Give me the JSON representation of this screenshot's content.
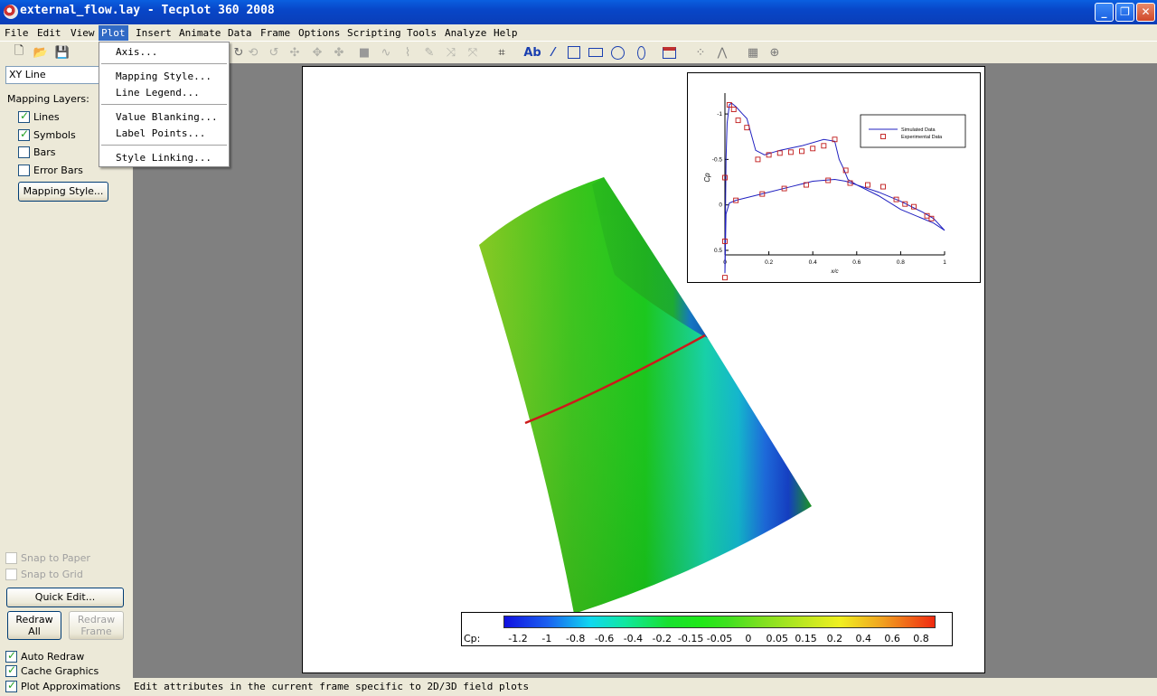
{
  "window": {
    "title": "external_flow.lay - Tecplot 360 2008",
    "controls": [
      "_",
      "❐",
      "✕"
    ]
  },
  "menubar": [
    {
      "label": "File",
      "active": false
    },
    {
      "label": "Edit",
      "active": false
    },
    {
      "label": "View",
      "active": false
    },
    {
      "label": "Plot",
      "active": true
    },
    {
      "label": "Insert",
      "active": false
    },
    {
      "label": "Animate",
      "active": false
    },
    {
      "label": "Data",
      "active": false
    },
    {
      "label": "Frame",
      "active": false
    },
    {
      "label": "Options",
      "active": false
    },
    {
      "label": "Scripting",
      "active": false
    },
    {
      "label": "Tools",
      "active": false
    },
    {
      "label": "Analyze",
      "active": false
    },
    {
      "label": "Help",
      "active": false
    }
  ],
  "plot_menu": [
    {
      "label": "Axis..."
    },
    {
      "label": "Mapping Style..."
    },
    {
      "label": "Line Legend..."
    },
    {
      "label": "Value Blanking..."
    },
    {
      "label": "Label Points..."
    },
    {
      "label": "Style Linking..."
    }
  ],
  "toolbar": {
    "text_tool_label": "Ab",
    "icons": [
      "new-file-icon",
      "open-folder-icon",
      "save-icon",
      "print-icon",
      "rotate-icon",
      "zoom-icon",
      "translate-icon",
      "probe-icon",
      "slice-icon",
      "streamtrace-icon",
      "contour-icon",
      "adjustor-icon",
      "select-icon",
      "text-icon",
      "polyline-icon",
      "rectangle-icon",
      "square-icon",
      "circle-icon",
      "ellipse-icon",
      "frame-icon",
      "scatter-icon",
      "line-icon",
      "grid-icon",
      "polar-icon"
    ]
  },
  "sidebar": {
    "plot_type": "XY Line",
    "mapping_layers_label": "Mapping Layers:",
    "layers": [
      {
        "label": "Lines",
        "checked": true
      },
      {
        "label": "Symbols",
        "checked": true
      },
      {
        "label": "Bars",
        "checked": false
      },
      {
        "label": "Error Bars",
        "checked": false
      }
    ],
    "mapping_style_button": "Mapping Style...",
    "snap": [
      {
        "label": "Snap to Paper",
        "checked": false,
        "enabled": false
      },
      {
        "label": "Snap to Grid",
        "checked": false,
        "enabled": false
      }
    ],
    "quick_edit_button": "Quick Edit...",
    "redraw_all_button": [
      "Redraw",
      "All"
    ],
    "redraw_frame_button": [
      "Redraw",
      "Frame"
    ],
    "options": [
      {
        "label": "Auto Redraw",
        "checked": true
      },
      {
        "label": "Cache Graphics",
        "checked": true
      },
      {
        "label": "Plot Approximations",
        "checked": true
      }
    ]
  },
  "status_text": "Edit attributes in the current frame specific to 2D/3D field plots",
  "colors": {
    "highlight": "#316ac5",
    "titlebar": "#0846c8",
    "surface_cut": "#cc1a1a",
    "simulated": "#2020c0",
    "experimental": "#c01818"
  },
  "colorbar": {
    "variable_label": "Cp:",
    "ticks": [
      "-1.2",
      "-1",
      "-0.8",
      "-0.6",
      "-0.4",
      "-0.2",
      "-0.15",
      "-0.05",
      "0",
      "0.05",
      "0.15",
      "0.2",
      "0.4",
      "0.6",
      "0.8"
    ]
  },
  "chart_data": {
    "type": "line",
    "xlabel": "x/c",
    "ylabel": "Cp",
    "xlim": [
      0,
      1
    ],
    "ylim": [
      0.55,
      -1.15
    ],
    "y_inverted": true,
    "xticks": [
      "0",
      "0.2",
      "0.4",
      "0.6",
      "0.8",
      "1"
    ],
    "yticks": [
      "-1",
      "-0.5",
      "0",
      "0.5"
    ],
    "legend": {
      "placement": "top-right",
      "entries": [
        "Simulated Data",
        "Experimental Data"
      ]
    },
    "series": [
      {
        "name": "Simulated Data",
        "style": "line",
        "x": [
          0,
          0.002,
          0.005,
          0.01,
          0.02,
          0.03,
          0.05,
          0.08,
          0.1,
          0.14,
          0.18,
          0.25,
          0.35,
          0.45,
          0.5,
          0.52,
          0.54,
          0.56,
          0.6,
          0.7,
          0.8,
          0.9,
          0.95,
          1.0
        ],
        "y": [
          0.75,
          0.2,
          -0.5,
          -0.9,
          -1.1,
          -1.12,
          -1.08,
          -1.0,
          -0.95,
          -0.6,
          -0.55,
          -0.6,
          -0.65,
          -0.72,
          -0.7,
          -0.5,
          -0.4,
          -0.28,
          -0.22,
          -0.1,
          0.05,
          0.15,
          0.2,
          0.28
        ]
      },
      {
        "name": "Simulated Data",
        "style": "line",
        "x": [
          0,
          0.005,
          0.02,
          0.05,
          0.1,
          0.2,
          0.3,
          0.4,
          0.5,
          0.55,
          0.6,
          0.7,
          0.8,
          0.9,
          0.95,
          1.0
        ],
        "y": [
          0.75,
          0.1,
          -0.02,
          -0.05,
          -0.08,
          -0.14,
          -0.2,
          -0.26,
          -0.28,
          -0.26,
          -0.22,
          -0.14,
          -0.04,
          0.08,
          0.15,
          0.28
        ]
      },
      {
        "name": "Experimental Data",
        "style": "markers",
        "x": [
          0.02,
          0.04,
          0.06,
          0.1,
          0.15,
          0.2,
          0.25,
          0.3,
          0.35,
          0.4,
          0.45,
          0.5,
          0.55
        ],
        "y": [
          -1.1,
          -1.05,
          -0.93,
          -0.85,
          -0.5,
          -0.55,
          -0.57,
          -0.58,
          -0.59,
          -0.62,
          -0.65,
          -0.72,
          -0.38
        ]
      },
      {
        "name": "Experimental Data",
        "style": "markers",
        "x": [
          0,
          0.0,
          0.0,
          0.05,
          0.17,
          0.27,
          0.37,
          0.47,
          0.57,
          0.65,
          0.72,
          0.78,
          0.82,
          0.86,
          0.92,
          0.94
        ],
        "y": [
          0.8,
          0.4,
          -0.3,
          -0.05,
          -0.12,
          -0.18,
          -0.22,
          -0.27,
          -0.24,
          -0.22,
          -0.2,
          -0.06,
          -0.01,
          0.02,
          0.12,
          0.15
        ]
      }
    ]
  }
}
